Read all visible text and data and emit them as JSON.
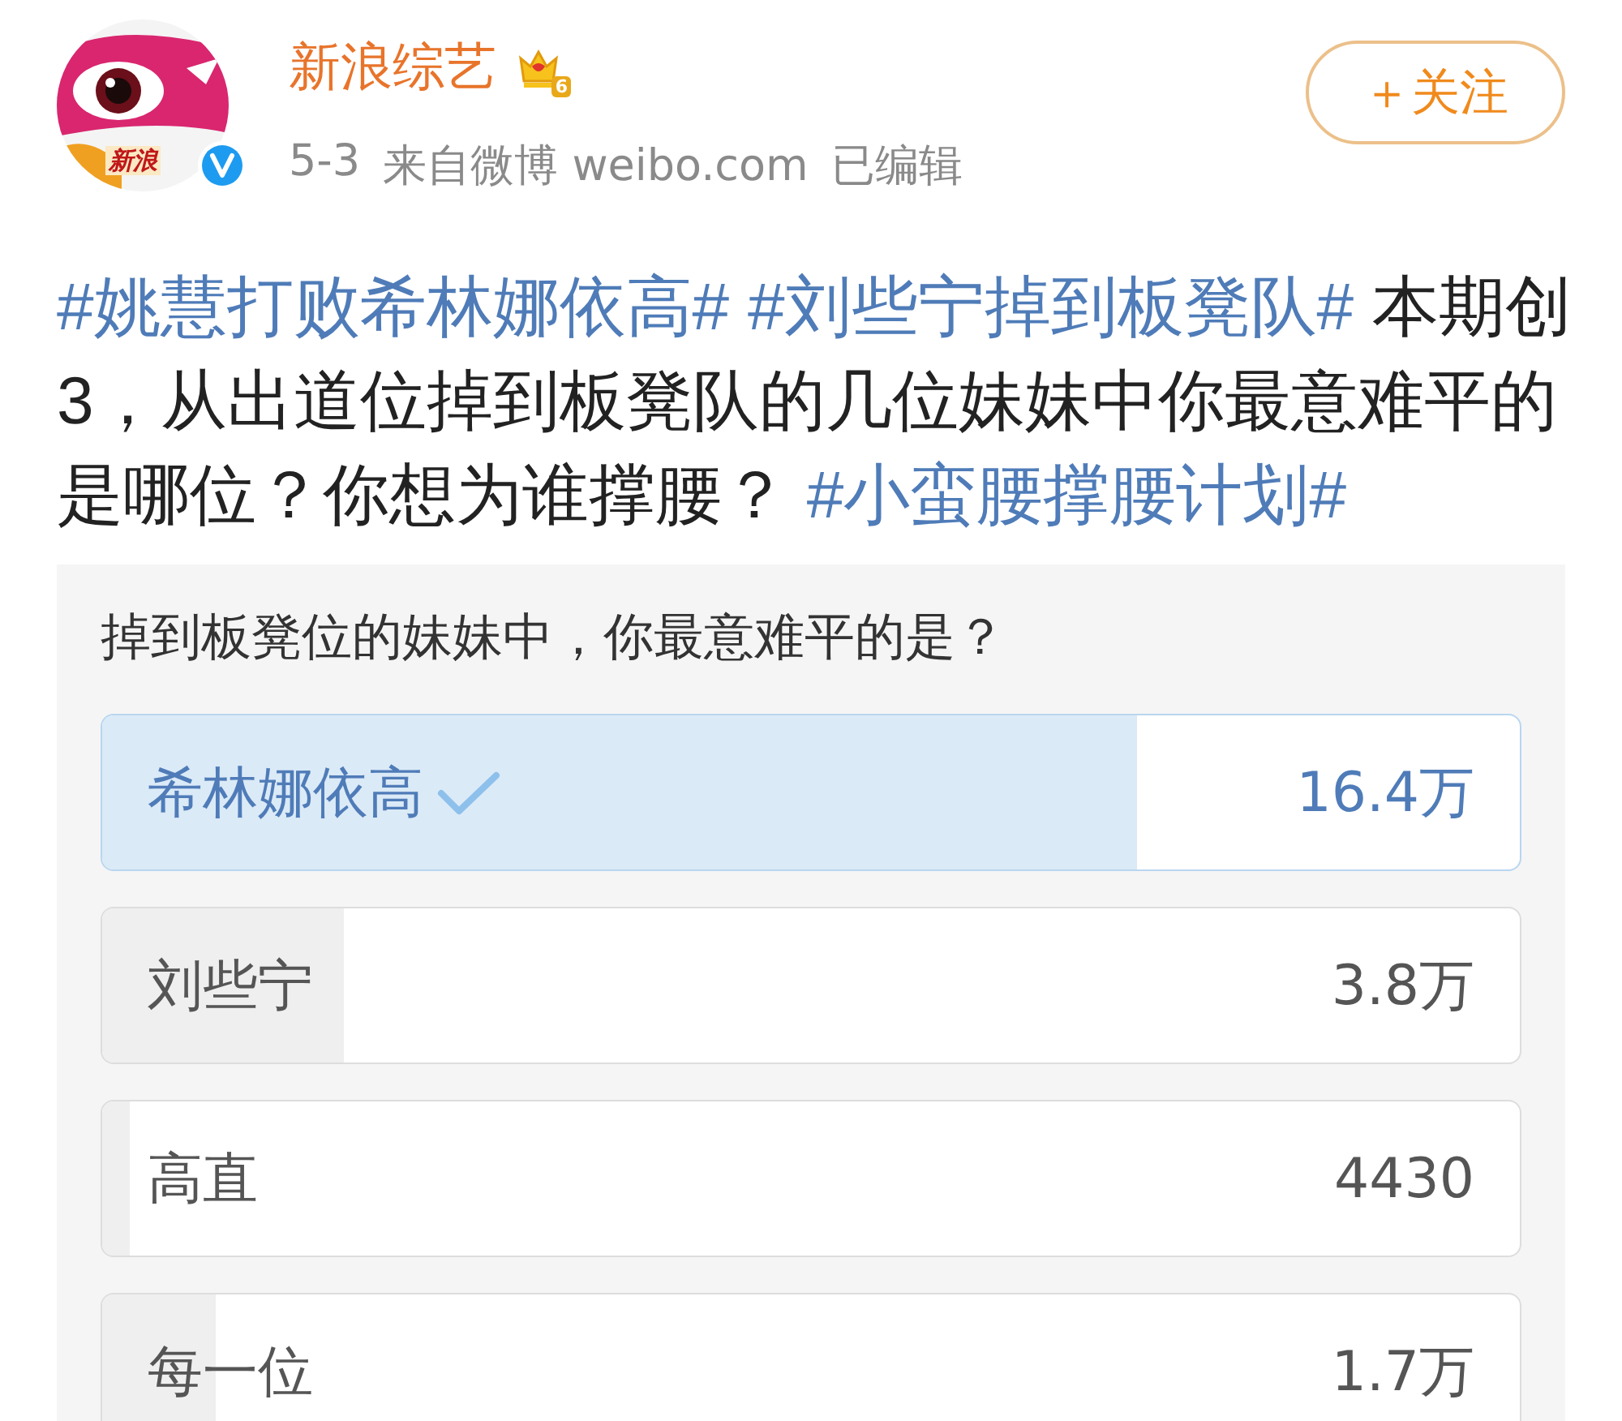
{
  "author": {
    "name": "新浪综艺",
    "avatar_label": "新浪",
    "verified": true,
    "level_badge": "6",
    "meta": [
      "5-3",
      "来自微博 weibo.com",
      "已编辑"
    ]
  },
  "follow_button": {
    "label": "＋关注"
  },
  "post": [
    {
      "kind": "hashtag",
      "text": "#姚慧打败希林娜依高# "
    },
    {
      "kind": "hashtag",
      "text": "#刘些宁掉到板凳队#"
    },
    {
      "kind": "text",
      "text": " 本期创3，从出道位掉到板凳队的几位妹妹中你最意难平的是哪位？你想为谁撑腰？ "
    },
    {
      "kind": "hashtag",
      "text": "#小蛮腰撑腰计划#"
    }
  ],
  "poll": {
    "question": "掉到板凳位的妹妹中，你最意难平的是？",
    "options": [
      {
        "label": "希林娜依高",
        "count": "16.4万",
        "level": 0.73,
        "selected": true
      },
      {
        "label": "刘些宁",
        "count": "3.8万",
        "level": 0.17,
        "selected": false
      },
      {
        "label": "高直",
        "count": "4430",
        "level": 0.02,
        "selected": false
      },
      {
        "label": "每一位",
        "count": "1.7万",
        "level": 0.08,
        "selected": false
      }
    ]
  }
}
